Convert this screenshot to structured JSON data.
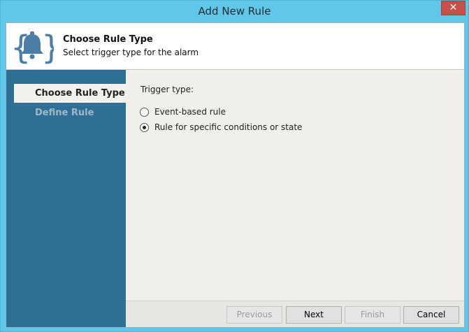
{
  "window": {
    "title": "Add New Rule",
    "close_label": "✕"
  },
  "header": {
    "icon": "bell-in-braces-icon",
    "title": "Choose Rule Type",
    "subtitle": "Select trigger type for the alarm"
  },
  "sidebar": {
    "steps": [
      {
        "label": "Choose Rule Type",
        "active": true
      },
      {
        "label": "Define Rule",
        "active": false
      }
    ]
  },
  "main": {
    "trigger_label": "Trigger type:",
    "options": [
      {
        "label": "Event-based rule",
        "checked": false
      },
      {
        "label": "Rule for specific conditions or state",
        "checked": true
      }
    ]
  },
  "footer": {
    "previous_label": "Previous",
    "next_label": "Next",
    "finish_label": "Finish",
    "cancel_label": "Cancel"
  },
  "colors": {
    "titlebar": "#61c7e8",
    "sidebar": "#2f6f96",
    "content_bg": "#f0efea",
    "close_button": "#c7504b"
  }
}
